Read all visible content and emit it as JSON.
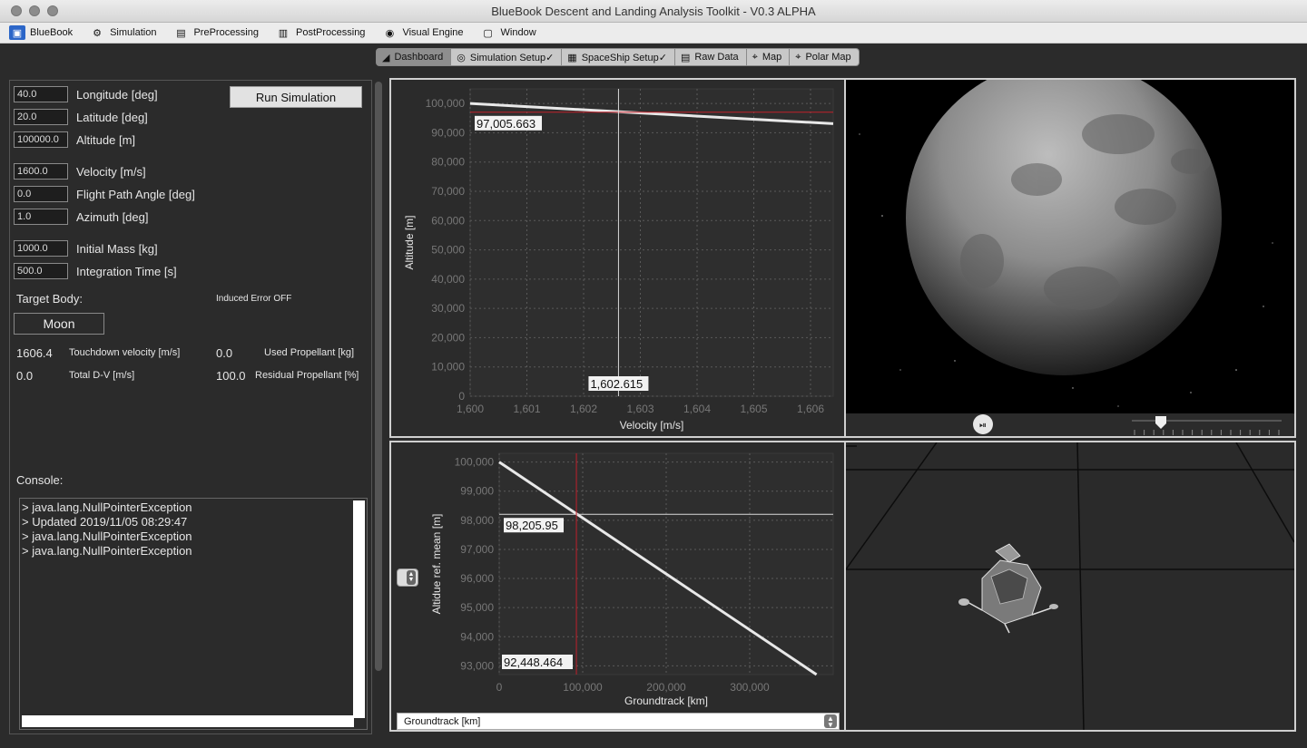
{
  "window": {
    "title": "BlueBook Descent and Landing Analysis Toolkit - V0.3 ALPHA"
  },
  "menu": [
    {
      "label": "BlueBook",
      "icon": "bluebook-logo-icon"
    },
    {
      "label": "Simulation",
      "icon": "simulation-icon"
    },
    {
      "label": "PreProcessing",
      "icon": "preprocessing-icon"
    },
    {
      "label": "PostProcessing",
      "icon": "postprocessing-icon"
    },
    {
      "label": "Visual Engine",
      "icon": "visual-engine-icon"
    },
    {
      "label": "Window",
      "icon": "window-icon"
    }
  ],
  "tabs": [
    {
      "label": "Dashboard",
      "icon": "dashboard-icon",
      "active": true
    },
    {
      "label": "Simulation Setup✓",
      "icon": "simulation-setup-icon",
      "active": false
    },
    {
      "label": "SpaceShip Setup✓",
      "icon": "spaceship-setup-icon",
      "active": false
    },
    {
      "label": "Raw Data",
      "icon": "raw-data-icon",
      "active": false
    },
    {
      "label": "Map",
      "icon": "map-icon",
      "active": false
    },
    {
      "label": "Polar Map",
      "icon": "polar-map-icon",
      "active": false
    }
  ],
  "inputs": {
    "longitude": {
      "value": "40.0",
      "label": "Longitude [deg]"
    },
    "latitude": {
      "value": "20.0",
      "label": "Latitude [deg]"
    },
    "altitude": {
      "value": "100000.0",
      "label": "Altitude [m]"
    },
    "velocity": {
      "value": "1600.0",
      "label": "Velocity [m/s]"
    },
    "fpa": {
      "value": "0.0",
      "label": "Flight Path Angle [deg]"
    },
    "azimuth": {
      "value": "1.0",
      "label": "Azimuth [deg]"
    },
    "mass": {
      "value": "1000.0",
      "label": "Initial Mass [kg]"
    },
    "time": {
      "value": "500.0",
      "label": "Integration Time [s]"
    }
  },
  "run_button": "Run Simulation",
  "target_body_label": "Target Body:",
  "induced_error": "Induced Error OFF",
  "target_body": "Moon",
  "results": {
    "touchdown_velocity_value": "1606.4",
    "touchdown_velocity_label": "Touchdown velocity [m/s]",
    "used_propellant_value": "0.0",
    "used_propellant_label": "Used Propellant [kg]",
    "total_dv_value": "0.0",
    "total_dv_label": "Total D-V [m/s]",
    "residual_propellant_value": "100.0",
    "residual_propellant_label": "Residual Propellant [%]"
  },
  "console": {
    "label": "Console:",
    "lines": [
      "> java.lang.NullPointerException",
      "> Updated 2019/11/05 08:29:47",
      "> java.lang.NullPointerException",
      "> java.lang.NullPointerException"
    ]
  },
  "groundtrack_select": "Groundtrack [km]",
  "colors": {
    "crosshair": "#c0202a",
    "series": "#e8e8e8",
    "grid": "#5a5a5a"
  },
  "chart_data": [
    {
      "type": "line",
      "xlabel": "Velocity [m/s]",
      "ylabel": "Altitude [m]",
      "xlim": [
        1600,
        1606.4
      ],
      "ylim": [
        0,
        105000
      ],
      "x_ticks": [
        "1,600",
        "1,601",
        "1,602",
        "1,603",
        "1,604",
        "1,605",
        "1,606"
      ],
      "y_ticks": [
        "0",
        "10,000",
        "20,000",
        "30,000",
        "40,000",
        "50,000",
        "60,000",
        "70,000",
        "80,000",
        "90,000",
        "100,000"
      ],
      "series": [
        {
          "x": [
            1600,
            1606.4
          ],
          "y": [
            100000,
            93100
          ]
        }
      ],
      "crosshair": {
        "x": 1602.615,
        "y": 97005.663,
        "x_label": "1,602.615",
        "y_label": "97,005.663"
      }
    },
    {
      "type": "line",
      "xlabel": "Groundtrack [km]",
      "ylabel": "Altidue ref. mean [m]",
      "xlim": [
        0,
        400000
      ],
      "ylim": [
        92700,
        100300
      ],
      "x_ticks": [
        "0",
        "100,000",
        "200,000",
        "300,000"
      ],
      "y_ticks": [
        "93,000",
        "94,000",
        "95,000",
        "96,000",
        "97,000",
        "98,000",
        "99,000",
        "100,000"
      ],
      "series": [
        {
          "x": [
            0,
            380000
          ],
          "y": [
            100000,
            92700
          ]
        }
      ],
      "crosshair": {
        "x": 92448.464,
        "y": 98205.95,
        "x_label": "92,448.464",
        "y_label": "98,205.95"
      }
    }
  ]
}
